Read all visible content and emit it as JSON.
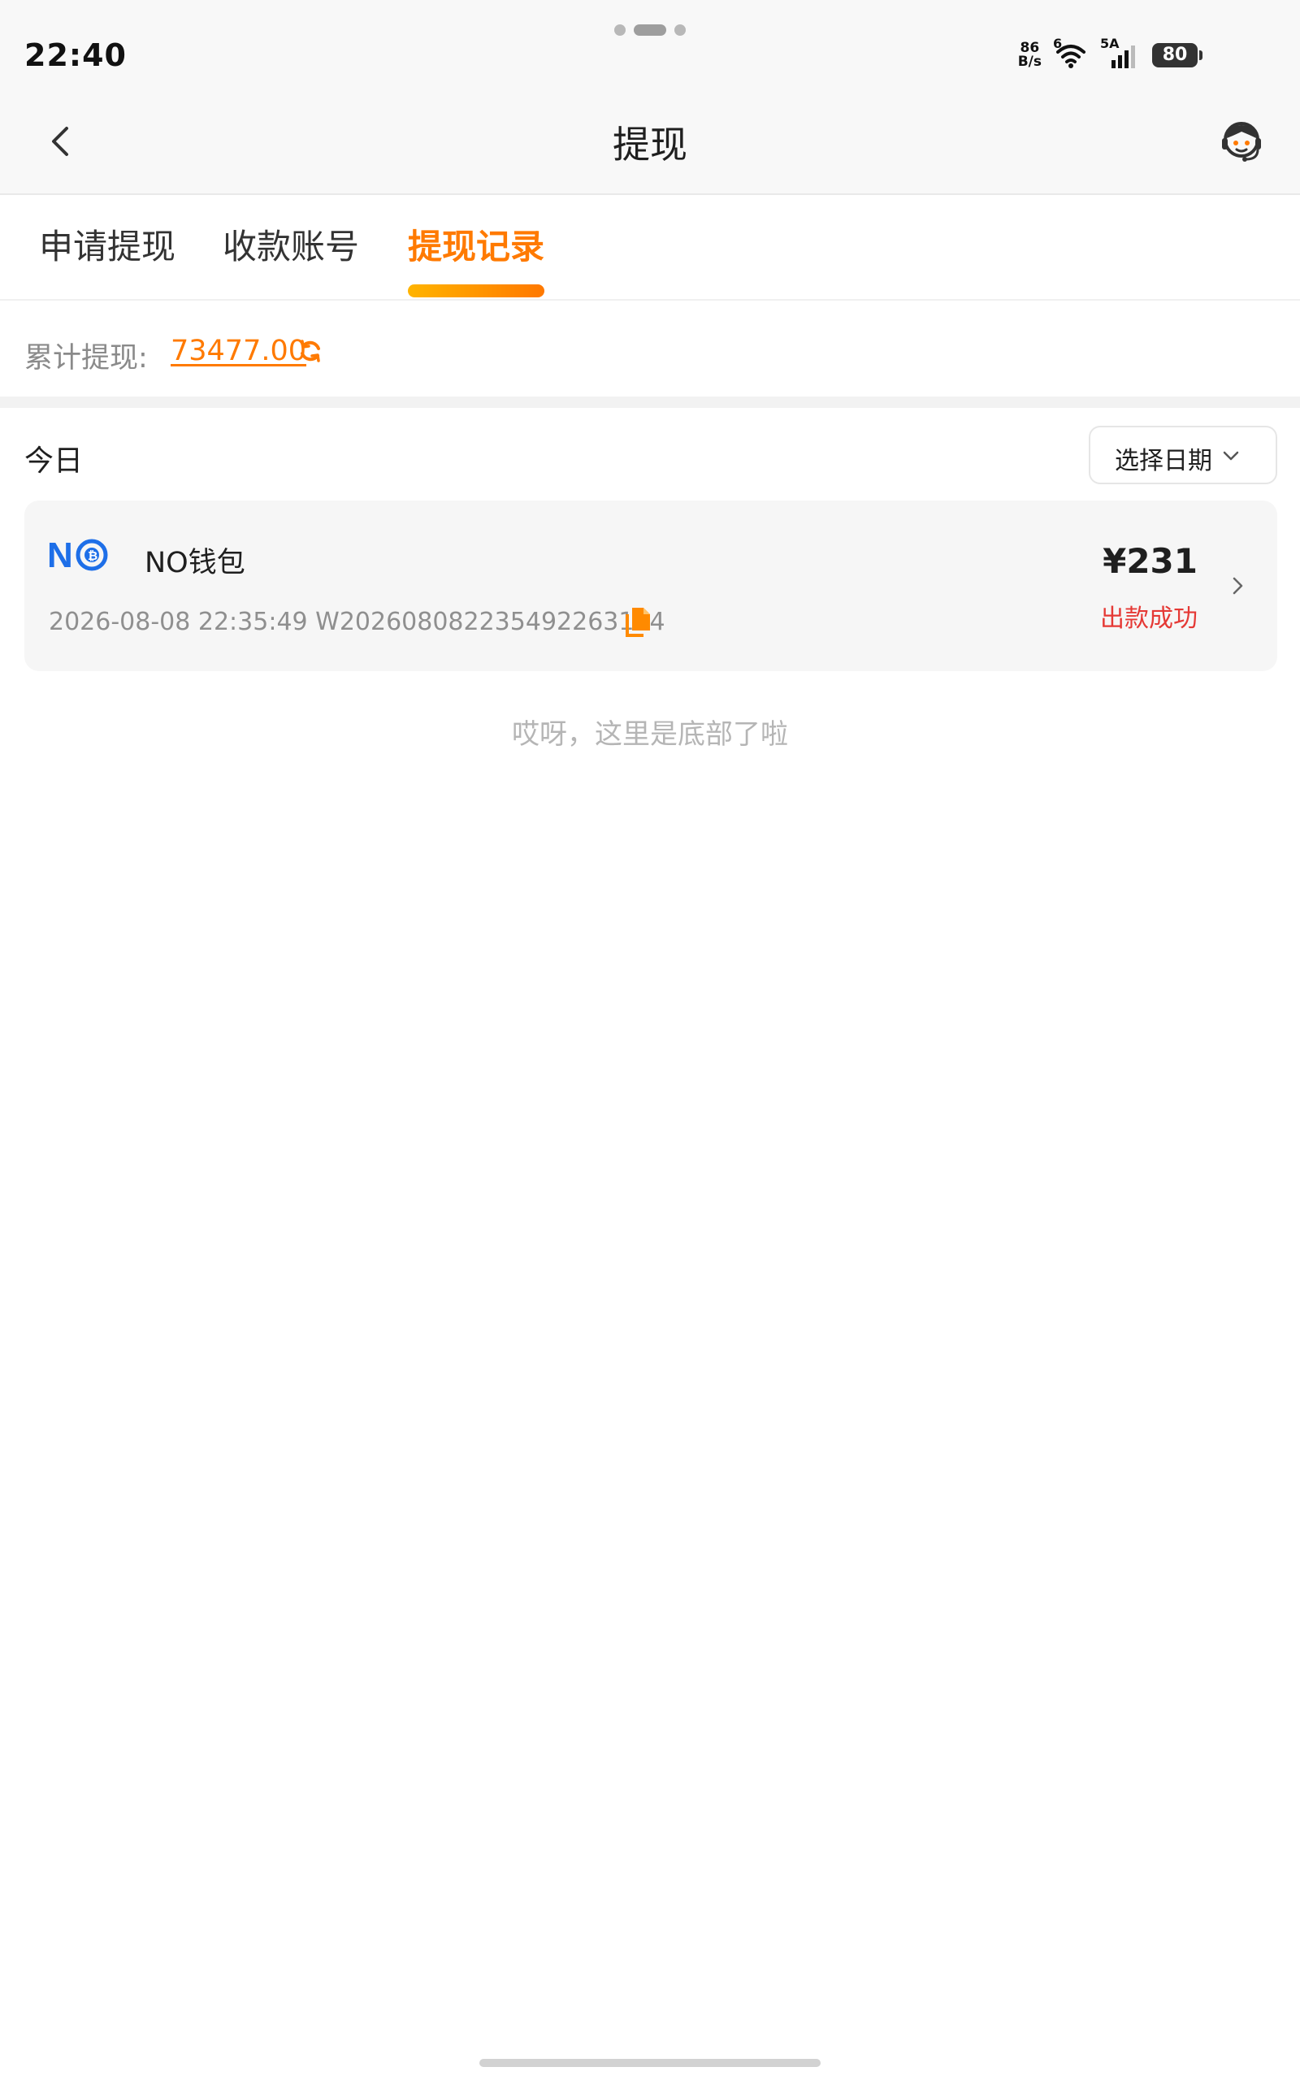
{
  "status_bar": {
    "time": "22:40",
    "net_speed_value": "86",
    "net_speed_unit": "B/s",
    "wifi_label": "6",
    "signal_label": "5A",
    "battery": "80"
  },
  "nav": {
    "title": "提现"
  },
  "tabs": [
    {
      "label": "申请提现",
      "active": false
    },
    {
      "label": "收款账号",
      "active": false
    },
    {
      "label": "提现记录",
      "active": true
    }
  ],
  "summary": {
    "label": "累计提现:",
    "value": "73477.00"
  },
  "list": {
    "date_group": "今日",
    "date_picker_label": "选择日期",
    "records": [
      {
        "wallet_logo_text": "NO",
        "wallet_name": "NO钱包",
        "meta": "2026-08-08 22:35:49 W20260808223549226319​4",
        "amount": "¥231",
        "status": "出款成功"
      }
    ],
    "end_text": "哎呀，这里是底部了啦"
  },
  "colors": {
    "accent": "#ff7a00",
    "status_success": "#e53935",
    "logo_blue": "#1e6fe8"
  }
}
